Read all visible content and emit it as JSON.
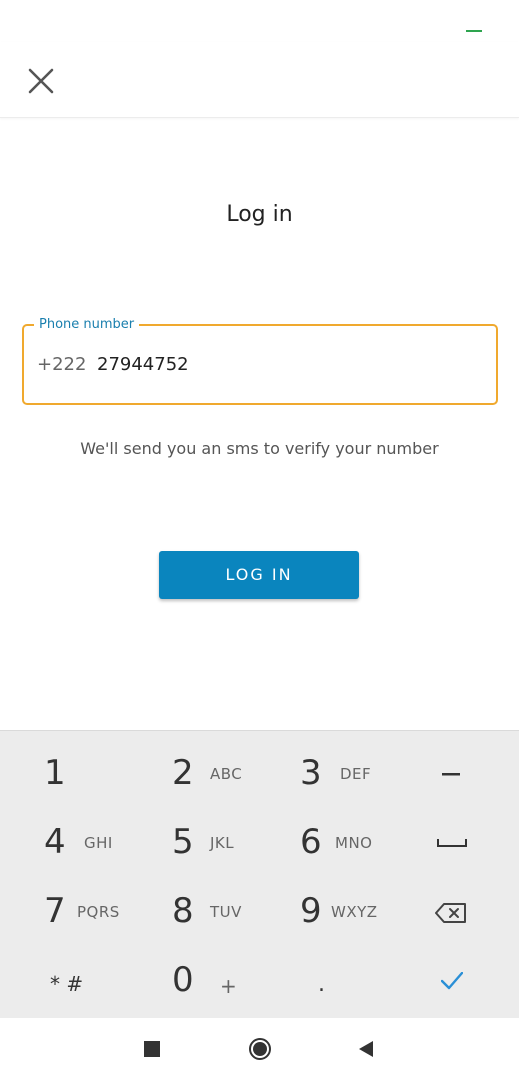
{
  "header": {
    "close_icon": "close-icon"
  },
  "page": {
    "title": "Log in"
  },
  "phone_field": {
    "label": "Phone number",
    "country_code": "+222",
    "value": "27944752"
  },
  "helper_text": "We'll send you an sms to verify your number",
  "login_button": {
    "label": "LOG IN"
  },
  "keypad": {
    "row1": [
      {
        "digit": "1",
        "letters": ""
      },
      {
        "digit": "2",
        "letters": "ABC"
      },
      {
        "digit": "3",
        "letters": "DEF"
      },
      {
        "digit": "",
        "letters": "",
        "icon": "minus-icon"
      }
    ],
    "row2": [
      {
        "digit": "4",
        "letters": "GHI"
      },
      {
        "digit": "5",
        "letters": "JKL"
      },
      {
        "digit": "6",
        "letters": "MNO"
      },
      {
        "digit": "",
        "letters": "",
        "icon": "space-icon"
      }
    ],
    "row3": [
      {
        "digit": "7",
        "letters": "PQRS"
      },
      {
        "digit": "8",
        "letters": "TUV"
      },
      {
        "digit": "9",
        "letters": "WXYZ"
      },
      {
        "digit": "",
        "letters": "",
        "icon": "backspace-icon"
      }
    ],
    "row4": [
      {
        "digit": "* #",
        "letters": ""
      },
      {
        "digit": "0",
        "letters": "+"
      },
      {
        "digit": ".",
        "letters": ""
      },
      {
        "digit": "",
        "letters": "",
        "icon": "check-icon"
      }
    ]
  },
  "nav": {
    "recents": "recents-icon",
    "home": "home-icon",
    "back": "back-icon"
  },
  "colors": {
    "accent": "#0a85be",
    "field_focus": "#f0a92e",
    "label": "#1a7fae",
    "check": "#2a8fd6"
  }
}
